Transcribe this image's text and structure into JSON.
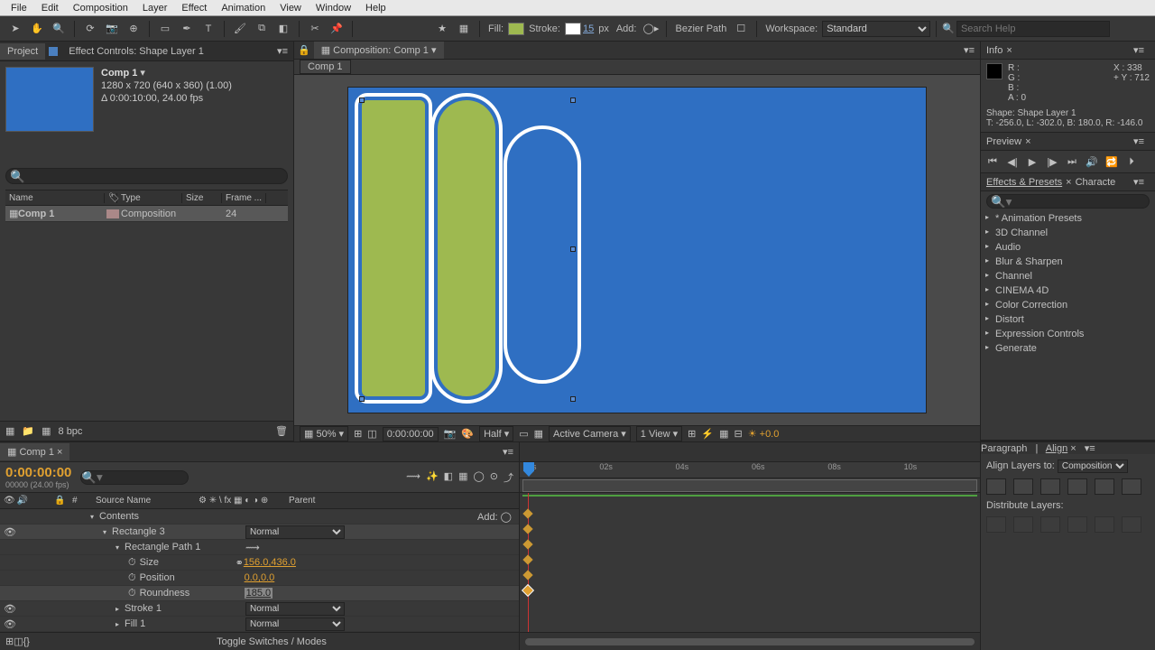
{
  "menubar": [
    "File",
    "Edit",
    "Composition",
    "Layer",
    "Effect",
    "Animation",
    "View",
    "Window",
    "Help"
  ],
  "toolbar": {
    "fill_label": "Fill:",
    "stroke_label": "Stroke:",
    "stroke_px": "15",
    "px_label": "px",
    "add_label": "Add:",
    "bezier_label": "Bezier Path",
    "workspace_label": "Workspace:",
    "workspace_value": "Standard",
    "search_placeholder": "Search Help"
  },
  "project": {
    "tab_project": "Project",
    "tab_effect_controls": "Effect Controls: Shape Layer 1",
    "comp_name": "Comp 1",
    "dims": "1280 x 720  (640 x 360) (1.00)",
    "dur": "Δ 0:00:10:00, 24.00 fps",
    "cols": {
      "name": "Name",
      "type": "Type",
      "size": "Size",
      "frame": "Frame ..."
    },
    "row_name": "Comp 1",
    "row_type": "Composition",
    "row_fps": "24",
    "bpc": "8 bpc"
  },
  "comp": {
    "label": "Composition: Comp 1",
    "tab": "Comp 1",
    "zoom": "50%",
    "time": "0:00:00:00",
    "res": "Half",
    "camera": "Active Camera",
    "view": "1 View",
    "exposure": "+0.0"
  },
  "info": {
    "title": "Info",
    "r": "R :",
    "g": "G :",
    "b": "B :",
    "a": "A :  0",
    "x": "X : 338",
    "y": "Y : 712",
    "shape": "Shape: Shape Layer 1",
    "bounds": "T: -256.0, L: -302.0, B: 180.0, R: -146.0"
  },
  "preview": {
    "title": "Preview"
  },
  "effects": {
    "tab1": "Effects & Presets",
    "tab2": "Characte",
    "items": [
      "* Animation Presets",
      "3D Channel",
      "Audio",
      "Blur & Sharpen",
      "Channel",
      "CINEMA 4D",
      "Color Correction",
      "Distort",
      "Expression Controls",
      "Generate"
    ]
  },
  "timeline": {
    "tab": "Comp 1",
    "timecode": "0:00:00:00",
    "frame": "00000 (24.00 fps)",
    "col_source": "Source Name",
    "col_parent": "Parent",
    "rows": {
      "contents": "Contents",
      "add": "Add:",
      "rect3": "Rectangle 3",
      "rect_path": "Rectangle Path 1",
      "size": "Size",
      "size_val": "156.0,436.0",
      "position": "Position",
      "position_val": "0.0,0.0",
      "roundness": "Roundness",
      "roundness_val": "185.0",
      "stroke1": "Stroke 1",
      "fill1": "Fill 1",
      "normal": "Normal"
    },
    "toggle": "Toggle Switches / Modes",
    "marks": [
      "00s",
      "02s",
      "04s",
      "06s",
      "08s",
      "10s"
    ]
  },
  "align": {
    "tab1": "Paragraph",
    "tab2": "Align",
    "align_to": "Align Layers to:",
    "align_to_val": "Composition",
    "dist": "Distribute Layers:"
  }
}
